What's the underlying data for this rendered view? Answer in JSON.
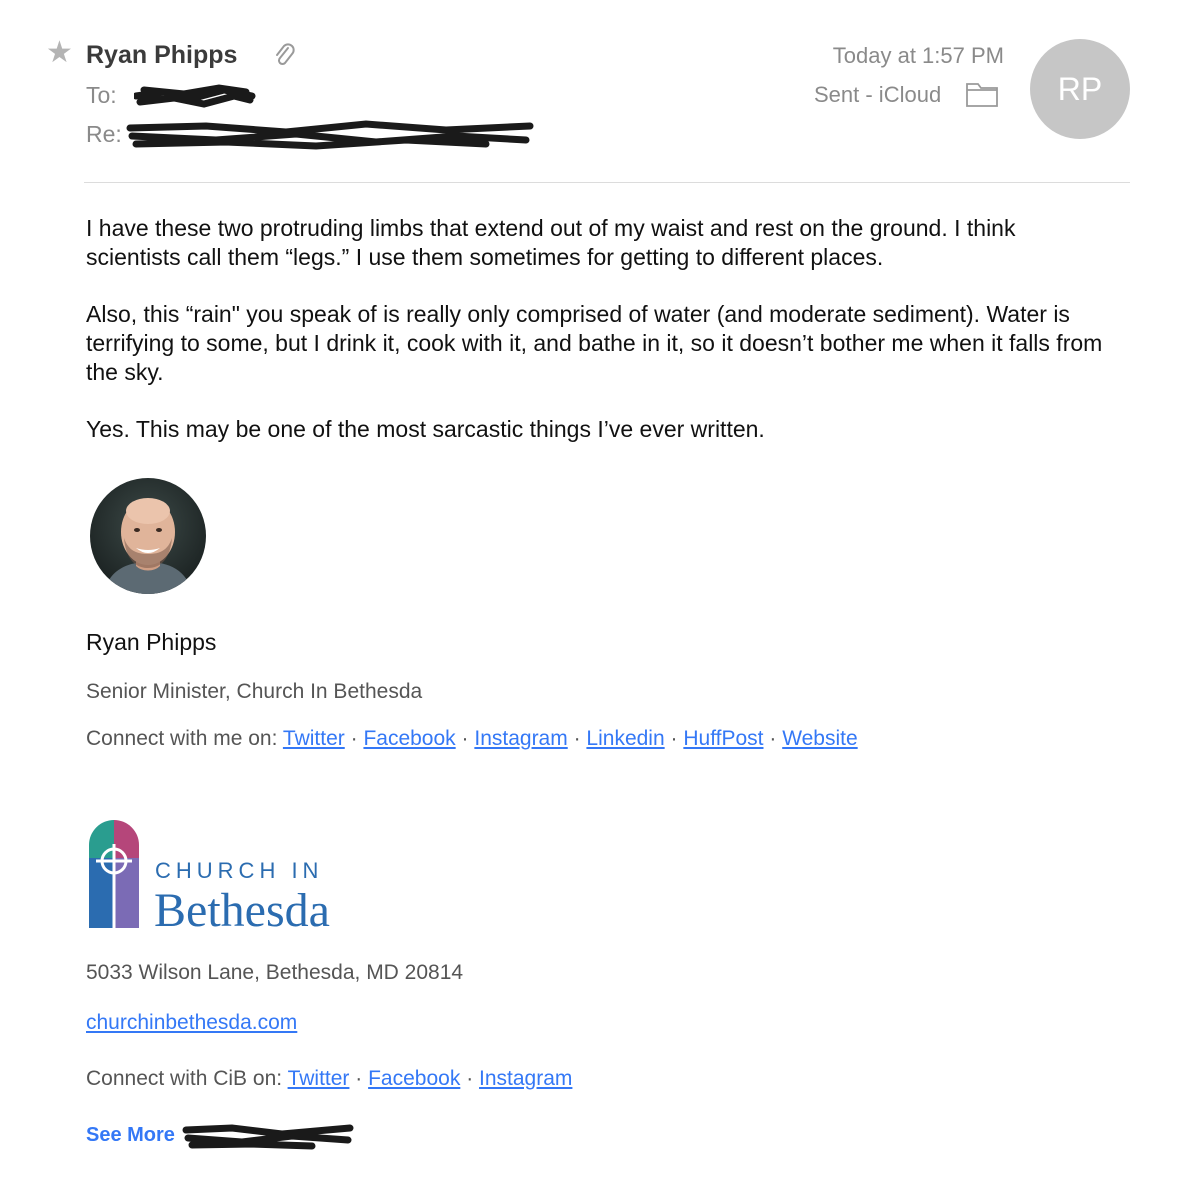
{
  "header": {
    "sender_name": "Ryan Phipps",
    "to_label": "To:",
    "re_label": "Re:",
    "date": "Today at 1:57 PM",
    "mailbox": "Sent - iCloud",
    "avatar_initials": "RP",
    "icons": {
      "star": "star-icon",
      "attachment": "paperclip-icon",
      "folder": "folder-icon"
    }
  },
  "body": {
    "paragraphs": [
      "I have these two protruding limbs that extend out of my waist and rest on the ground. I think scientists call them “legs.” I use them sometimes for getting to different places.",
      "Also, this “rain\" you speak of is really only comprised of water (and moderate sediment). Water is terrifying to some, but I drink it, cook with it, and bathe in it, so it doesn’t bother me when it falls from the sky.",
      "Yes. This may be one of the most sarcastic things I’ve  ever written."
    ]
  },
  "signature": {
    "name": "Ryan Phipps",
    "title": "Senior Minister, Church In Bethesda",
    "connect_label": "Connect with me on:",
    "links": [
      "Twitter",
      "Facebook",
      "Instagram",
      "Linkedin",
      "HuffPost",
      "Website"
    ],
    "separator": "·",
    "logo": {
      "line1": "CHURCH IN",
      "line2": "Bethesda"
    },
    "address": "5033 Wilson Lane, Bethesda, MD 20814",
    "website": "churchinbethesda.com",
    "cib_connect_label": "Connect with CiB on:",
    "cib_links": [
      "Twitter",
      "Facebook",
      "Instagram"
    ],
    "see_more": "See More"
  },
  "colors": {
    "link": "#3478f6",
    "avatar_bg": "#c6c6c6",
    "logo_teal": "#2a9d8f",
    "logo_blue": "#2b6cb0",
    "logo_purple": "#7b6bb5",
    "logo_magenta": "#b5467a"
  }
}
